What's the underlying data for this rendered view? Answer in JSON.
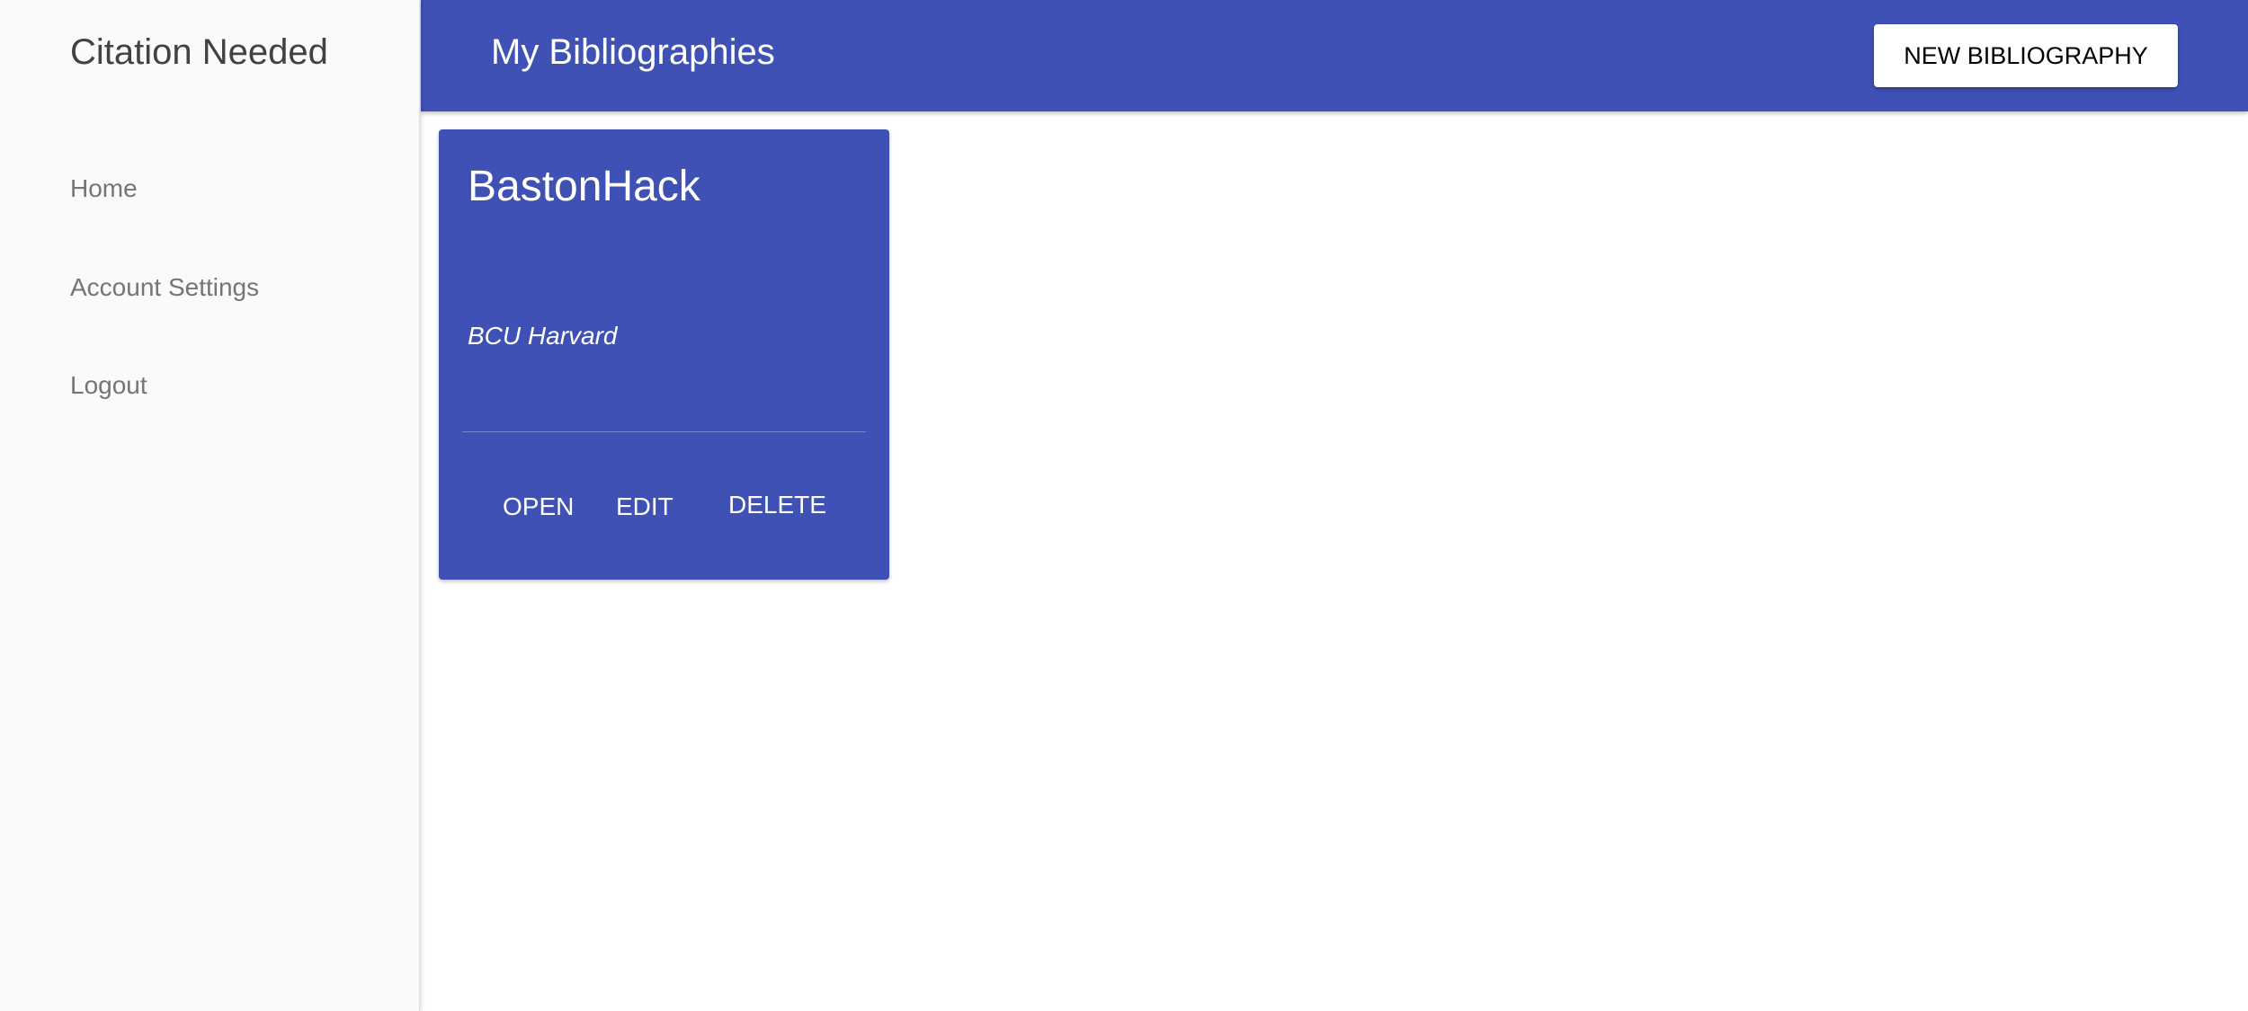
{
  "sidebar": {
    "brand": "Citation Needed",
    "items": [
      {
        "label": "Home"
      },
      {
        "label": "Account Settings"
      },
      {
        "label": "Logout"
      }
    ]
  },
  "header": {
    "title": "My Bibliographies",
    "new_button_label": "NEW BIBLIOGRAPHY"
  },
  "bibliographies": [
    {
      "title": "BastonHack",
      "style": "BCU Harvard",
      "actions": {
        "open": "OPEN",
        "edit": "EDIT",
        "delete": "DELETE"
      }
    }
  ],
  "colors": {
    "primary": "#3f51b5",
    "sidebar_bg": "#fafafa",
    "nav_text": "#757575",
    "brand_text": "#424242"
  }
}
